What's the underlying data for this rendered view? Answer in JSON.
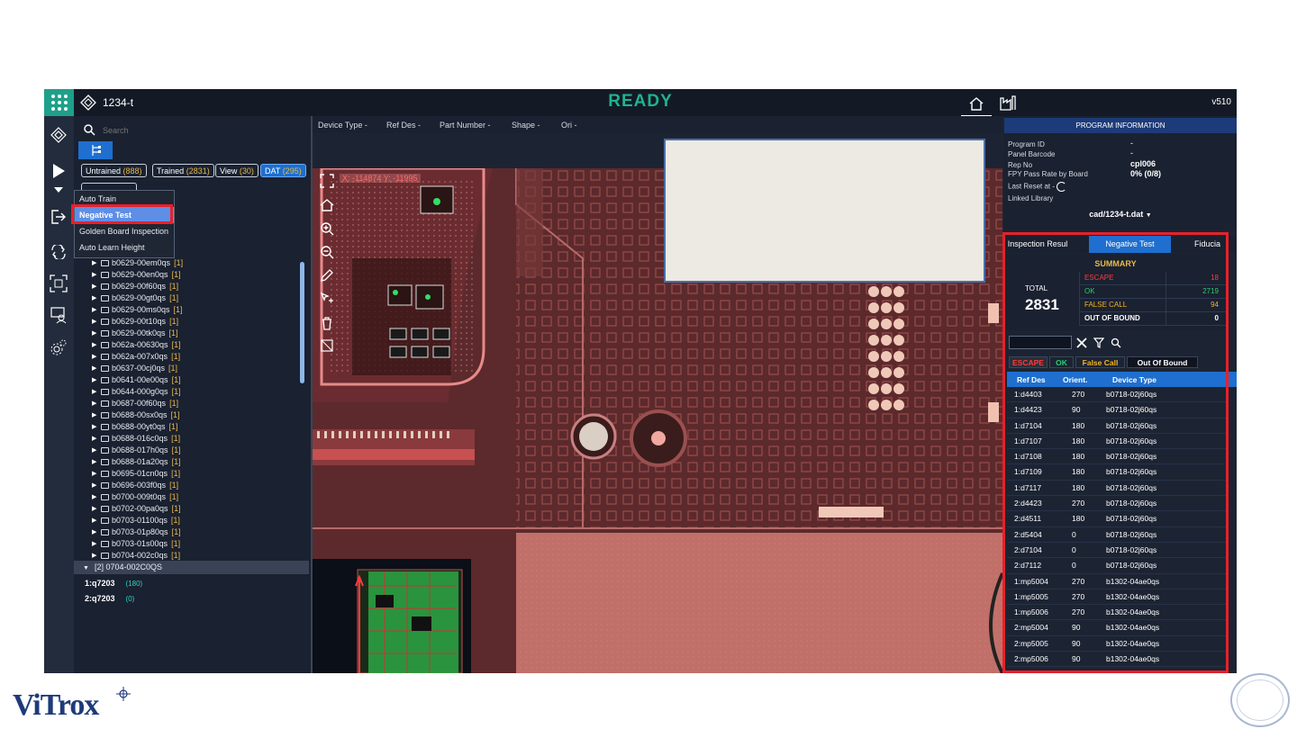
{
  "topbar": {
    "program_name": "1234-t",
    "status": "READY",
    "version": "v510"
  },
  "tree": {
    "search_placeholder": "Search",
    "chips": [
      {
        "label": "Untrained",
        "count": "(888)"
      },
      {
        "label": "Trained",
        "count": "(2831)"
      },
      {
        "label": "View",
        "count": "(30)"
      },
      {
        "label": "DAT",
        "count": "(295)"
      }
    ],
    "items": [
      {
        "name": "b0629-00em0qs",
        "count": "[1]"
      },
      {
        "name": "b0629-00en0qs",
        "count": "[1]"
      },
      {
        "name": "b0629-00f60qs",
        "count": "[1]"
      },
      {
        "name": "b0629-00gt0qs",
        "count": "[1]"
      },
      {
        "name": "b0629-00ms0qs",
        "count": "[1]"
      },
      {
        "name": "b0629-00t10qs",
        "count": "[1]"
      },
      {
        "name": "b0629-00tk0qs",
        "count": "[1]"
      },
      {
        "name": "b062a-00630qs",
        "count": "[1]"
      },
      {
        "name": "b062a-007x0qs",
        "count": "[1]"
      },
      {
        "name": "b0637-00cj0qs",
        "count": "[1]"
      },
      {
        "name": "b0641-00e00qs",
        "count": "[1]"
      },
      {
        "name": "b0644-000g0qs",
        "count": "[1]"
      },
      {
        "name": "b0687-00f60qs",
        "count": "[1]"
      },
      {
        "name": "b0688-00sx0qs",
        "count": "[1]"
      },
      {
        "name": "b0688-00yt0qs",
        "count": "[1]"
      },
      {
        "name": "b0688-016c0qs",
        "count": "[1]"
      },
      {
        "name": "b0688-017h0qs",
        "count": "[1]"
      },
      {
        "name": "b0688-01a20qs",
        "count": "[1]"
      },
      {
        "name": "b0695-01cn0qs",
        "count": "[1]"
      },
      {
        "name": "b0696-003f0qs",
        "count": "[1]"
      },
      {
        "name": "b0700-009t0qs",
        "count": "[1]"
      },
      {
        "name": "b0702-00pa0qs",
        "count": "[1]"
      },
      {
        "name": "b0703-01100qs",
        "count": "[1]"
      },
      {
        "name": "b0703-01p80qs",
        "count": "[1]"
      },
      {
        "name": "b0703-01s00qs",
        "count": "[1]"
      },
      {
        "name": "b0704-002c0qs",
        "count": "[1]"
      }
    ],
    "group": "[2] 0704-002C0QS",
    "parts": [
      {
        "ref": "1:q7203",
        "deg": "(180)"
      },
      {
        "ref": "2:q7203",
        "deg": "(0)"
      }
    ]
  },
  "menu": {
    "items": [
      "Auto Train",
      "Negative Test",
      "Golden Board Inspection",
      "Auto Learn Height"
    ],
    "selected": "Negative Test"
  },
  "filters": [
    "Device Type",
    "Ref Des",
    "Part Number",
    "Shape",
    "Ori"
  ],
  "filter_value": "-",
  "coord": "X: -114874 Y: -11995",
  "program_info": {
    "header": "PROGRAM INFORMATION",
    "rows": [
      {
        "label": "Program ID",
        "value": "-"
      },
      {
        "label": "Panel Barcode",
        "value": "-"
      },
      {
        "label": "Rep No",
        "value": "cpl006"
      },
      {
        "label": "FPY Pass Rate by Board",
        "value": "0% (0/8)"
      }
    ],
    "last_reset": "Last Reset at -",
    "linked_library_label": "Linked Library",
    "linked_library": "cad/1234-t.dat"
  },
  "tabs": [
    "Inspection Resul",
    "Negative Test",
    "Fiducia"
  ],
  "summary": {
    "title": "SUMMARY",
    "total_label": "TOTAL",
    "total": "2831",
    "rows": [
      {
        "label": "ESCAPE",
        "value": "18"
      },
      {
        "label": "OK",
        "value": "2719"
      },
      {
        "label": "FALSE CALL",
        "value": "94"
      },
      {
        "label": "OUT OF BOUND",
        "value": "0"
      }
    ]
  },
  "segments": [
    "ESCAPE",
    "OK",
    "False Call",
    "Out Of Bound"
  ],
  "list": {
    "headers": [
      "Ref Des",
      "Orient.",
      "Device Type"
    ],
    "rows": [
      [
        "1:d4403",
        "270",
        "b0718-02j60qs"
      ],
      [
        "1:d4423",
        "90",
        "b0718-02j60qs"
      ],
      [
        "1:d7104",
        "180",
        "b0718-02j60qs"
      ],
      [
        "1:d7107",
        "180",
        "b0718-02j60qs"
      ],
      [
        "1:d7108",
        "180",
        "b0718-02j60qs"
      ],
      [
        "1:d7109",
        "180",
        "b0718-02j60qs"
      ],
      [
        "1:d7117",
        "180",
        "b0718-02j60qs"
      ],
      [
        "2:d4423",
        "270",
        "b0718-02j60qs"
      ],
      [
        "2:d4511",
        "180",
        "b0718-02j60qs"
      ],
      [
        "2:d5404",
        "0",
        "b0718-02j60qs"
      ],
      [
        "2:d7104",
        "0",
        "b0718-02j60qs"
      ],
      [
        "2:d7112",
        "0",
        "b0718-02j60qs"
      ],
      [
        "1:mp5004",
        "270",
        "b1302-04ae0qs"
      ],
      [
        "1:mp5005",
        "270",
        "b1302-04ae0qs"
      ],
      [
        "1:mp5006",
        "270",
        "b1302-04ae0qs"
      ],
      [
        "2:mp5004",
        "90",
        "b1302-04ae0qs"
      ],
      [
        "2:mp5005",
        "90",
        "b1302-04ae0qs"
      ],
      [
        "2:mp5006",
        "90",
        "b1302-04ae0qs"
      ]
    ]
  },
  "brand": "ViTrox",
  "colors": {
    "accent": "#1fa08a",
    "ready": "#1fb38f",
    "selected_tab": "#1e6fcf",
    "escape": "#ff3b3b",
    "ok": "#2ecc71",
    "false_call": "#f0b429",
    "highlight": "#e8202a"
  }
}
